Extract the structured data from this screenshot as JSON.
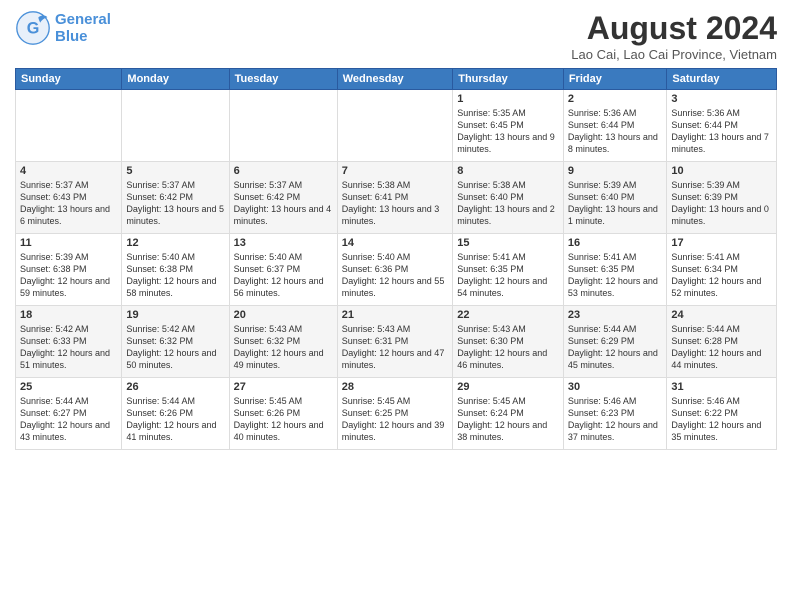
{
  "header": {
    "logo_general": "General",
    "logo_blue": "Blue",
    "month_year": "August 2024",
    "location": "Lao Cai, Lao Cai Province, Vietnam"
  },
  "weekdays": [
    "Sunday",
    "Monday",
    "Tuesday",
    "Wednesday",
    "Thursday",
    "Friday",
    "Saturday"
  ],
  "weeks": [
    [
      {
        "day": "",
        "sunrise": "",
        "sunset": "",
        "daylight": ""
      },
      {
        "day": "",
        "sunrise": "",
        "sunset": "",
        "daylight": ""
      },
      {
        "day": "",
        "sunrise": "",
        "sunset": "",
        "daylight": ""
      },
      {
        "day": "",
        "sunrise": "",
        "sunset": "",
        "daylight": ""
      },
      {
        "day": "1",
        "sunrise": "Sunrise: 5:35 AM",
        "sunset": "Sunset: 6:45 PM",
        "daylight": "Daylight: 13 hours and 9 minutes."
      },
      {
        "day": "2",
        "sunrise": "Sunrise: 5:36 AM",
        "sunset": "Sunset: 6:44 PM",
        "daylight": "Daylight: 13 hours and 8 minutes."
      },
      {
        "day": "3",
        "sunrise": "Sunrise: 5:36 AM",
        "sunset": "Sunset: 6:44 PM",
        "daylight": "Daylight: 13 hours and 7 minutes."
      }
    ],
    [
      {
        "day": "4",
        "sunrise": "Sunrise: 5:37 AM",
        "sunset": "Sunset: 6:43 PM",
        "daylight": "Daylight: 13 hours and 6 minutes."
      },
      {
        "day": "5",
        "sunrise": "Sunrise: 5:37 AM",
        "sunset": "Sunset: 6:42 PM",
        "daylight": "Daylight: 13 hours and 5 minutes."
      },
      {
        "day": "6",
        "sunrise": "Sunrise: 5:37 AM",
        "sunset": "Sunset: 6:42 PM",
        "daylight": "Daylight: 13 hours and 4 minutes."
      },
      {
        "day": "7",
        "sunrise": "Sunrise: 5:38 AM",
        "sunset": "Sunset: 6:41 PM",
        "daylight": "Daylight: 13 hours and 3 minutes."
      },
      {
        "day": "8",
        "sunrise": "Sunrise: 5:38 AM",
        "sunset": "Sunset: 6:40 PM",
        "daylight": "Daylight: 13 hours and 2 minutes."
      },
      {
        "day": "9",
        "sunrise": "Sunrise: 5:39 AM",
        "sunset": "Sunset: 6:40 PM",
        "daylight": "Daylight: 13 hours and 1 minute."
      },
      {
        "day": "10",
        "sunrise": "Sunrise: 5:39 AM",
        "sunset": "Sunset: 6:39 PM",
        "daylight": "Daylight: 13 hours and 0 minutes."
      }
    ],
    [
      {
        "day": "11",
        "sunrise": "Sunrise: 5:39 AM",
        "sunset": "Sunset: 6:38 PM",
        "daylight": "Daylight: 12 hours and 59 minutes."
      },
      {
        "day": "12",
        "sunrise": "Sunrise: 5:40 AM",
        "sunset": "Sunset: 6:38 PM",
        "daylight": "Daylight: 12 hours and 58 minutes."
      },
      {
        "day": "13",
        "sunrise": "Sunrise: 5:40 AM",
        "sunset": "Sunset: 6:37 PM",
        "daylight": "Daylight: 12 hours and 56 minutes."
      },
      {
        "day": "14",
        "sunrise": "Sunrise: 5:40 AM",
        "sunset": "Sunset: 6:36 PM",
        "daylight": "Daylight: 12 hours and 55 minutes."
      },
      {
        "day": "15",
        "sunrise": "Sunrise: 5:41 AM",
        "sunset": "Sunset: 6:35 PM",
        "daylight": "Daylight: 12 hours and 54 minutes."
      },
      {
        "day": "16",
        "sunrise": "Sunrise: 5:41 AM",
        "sunset": "Sunset: 6:35 PM",
        "daylight": "Daylight: 12 hours and 53 minutes."
      },
      {
        "day": "17",
        "sunrise": "Sunrise: 5:41 AM",
        "sunset": "Sunset: 6:34 PM",
        "daylight": "Daylight: 12 hours and 52 minutes."
      }
    ],
    [
      {
        "day": "18",
        "sunrise": "Sunrise: 5:42 AM",
        "sunset": "Sunset: 6:33 PM",
        "daylight": "Daylight: 12 hours and 51 minutes."
      },
      {
        "day": "19",
        "sunrise": "Sunrise: 5:42 AM",
        "sunset": "Sunset: 6:32 PM",
        "daylight": "Daylight: 12 hours and 50 minutes."
      },
      {
        "day": "20",
        "sunrise": "Sunrise: 5:43 AM",
        "sunset": "Sunset: 6:32 PM",
        "daylight": "Daylight: 12 hours and 49 minutes."
      },
      {
        "day": "21",
        "sunrise": "Sunrise: 5:43 AM",
        "sunset": "Sunset: 6:31 PM",
        "daylight": "Daylight: 12 hours and 47 minutes."
      },
      {
        "day": "22",
        "sunrise": "Sunrise: 5:43 AM",
        "sunset": "Sunset: 6:30 PM",
        "daylight": "Daylight: 12 hours and 46 minutes."
      },
      {
        "day": "23",
        "sunrise": "Sunrise: 5:44 AM",
        "sunset": "Sunset: 6:29 PM",
        "daylight": "Daylight: 12 hours and 45 minutes."
      },
      {
        "day": "24",
        "sunrise": "Sunrise: 5:44 AM",
        "sunset": "Sunset: 6:28 PM",
        "daylight": "Daylight: 12 hours and 44 minutes."
      }
    ],
    [
      {
        "day": "25",
        "sunrise": "Sunrise: 5:44 AM",
        "sunset": "Sunset: 6:27 PM",
        "daylight": "Daylight: 12 hours and 43 minutes."
      },
      {
        "day": "26",
        "sunrise": "Sunrise: 5:44 AM",
        "sunset": "Sunset: 6:26 PM",
        "daylight": "Daylight: 12 hours and 41 minutes."
      },
      {
        "day": "27",
        "sunrise": "Sunrise: 5:45 AM",
        "sunset": "Sunset: 6:26 PM",
        "daylight": "Daylight: 12 hours and 40 minutes."
      },
      {
        "day": "28",
        "sunrise": "Sunrise: 5:45 AM",
        "sunset": "Sunset: 6:25 PM",
        "daylight": "Daylight: 12 hours and 39 minutes."
      },
      {
        "day": "29",
        "sunrise": "Sunrise: 5:45 AM",
        "sunset": "Sunset: 6:24 PM",
        "daylight": "Daylight: 12 hours and 38 minutes."
      },
      {
        "day": "30",
        "sunrise": "Sunrise: 5:46 AM",
        "sunset": "Sunset: 6:23 PM",
        "daylight": "Daylight: 12 hours and 37 minutes."
      },
      {
        "day": "31",
        "sunrise": "Sunrise: 5:46 AM",
        "sunset": "Sunset: 6:22 PM",
        "daylight": "Daylight: 12 hours and 35 minutes."
      }
    ]
  ]
}
